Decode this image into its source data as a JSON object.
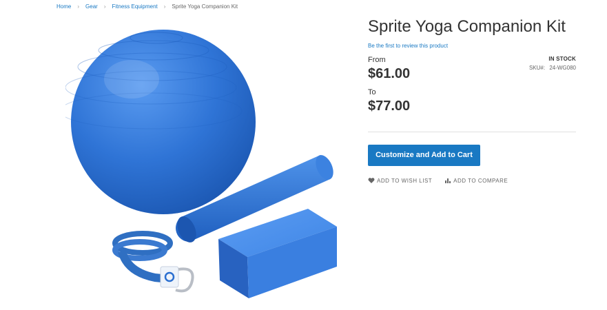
{
  "breadcrumbs": {
    "home": "Home",
    "gear": "Gear",
    "fitness": "Fitness Equipment",
    "current": "Sprite Yoga Companion Kit"
  },
  "product": {
    "title": "Sprite Yoga Companion Kit",
    "review_link": "Be the first to review this product",
    "stock": "IN STOCK",
    "sku_label": "SKU#:",
    "sku_value": "24-WG080",
    "price_from_label": "From",
    "price_from": "$61.00",
    "price_to_label": "To",
    "price_to": "$77.00",
    "add_to_cart_label": "Customize and Add to Cart",
    "wishlist_label": "Add to Wish List",
    "compare_label": "Add to Compare"
  },
  "colors": {
    "accent": "#1979c3",
    "product_blue": "#2b6fd0"
  },
  "icons": {
    "wishlist": "heart-icon",
    "compare": "bar-chart-icon"
  }
}
